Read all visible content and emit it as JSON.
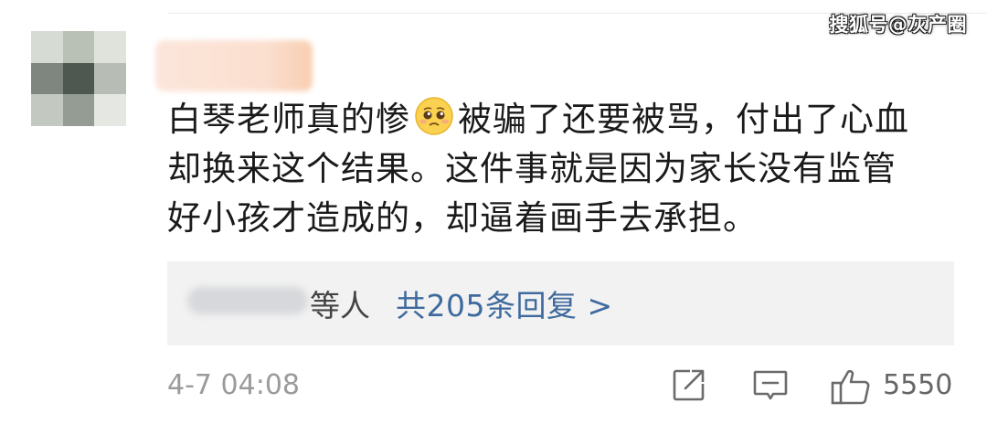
{
  "watermark": "搜狐号@灰产圈",
  "comment": {
    "lines": [
      {
        "before_emoji": "白琴老师真的惨",
        "after_emoji": "被骗了还要被骂，付出了心血"
      },
      {
        "text": "却换来这个结果。这件事就是因为家长没有监管"
      },
      {
        "text": "好小孩才造成的，却逼着画手去承担。"
      }
    ],
    "emoji": "pleading-face-icon"
  },
  "replies": {
    "names_suffix": "等人",
    "link_label": "共205条回复 >"
  },
  "footer": {
    "timestamp": "4-7 04:08",
    "like_count": "5550"
  },
  "colors": {
    "link": "#3f6a9e",
    "reply_bg": "#f2f2f2",
    "text": "#1a1a1a",
    "muted": "#9b9b9b"
  }
}
